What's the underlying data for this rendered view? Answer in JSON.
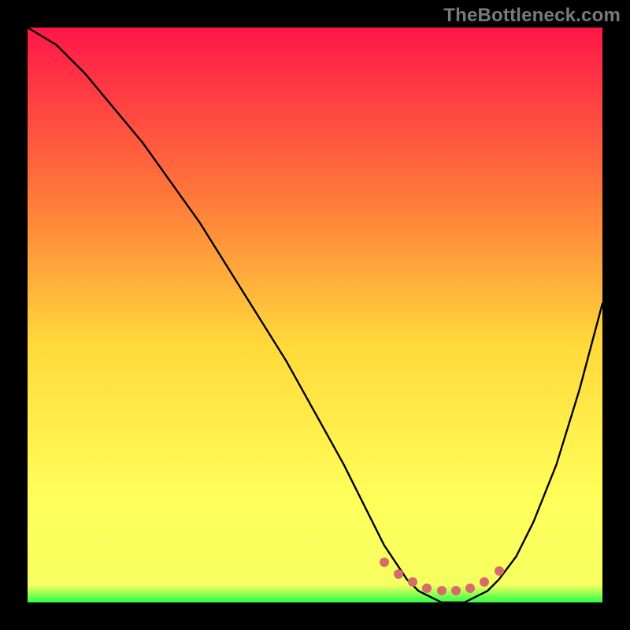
{
  "watermark": "TheBottleneck.com",
  "colors": {
    "bg": "#000000",
    "wm": "#7a7a7a",
    "curve": "#000000",
    "markers": "#d96a6a",
    "grad_top": "#ff1648",
    "grad_mid1": "#ff7a3a",
    "grad_mid2": "#ffd93a",
    "grad_mid3": "#ffff5a",
    "grad_bottom": "#2cff48"
  },
  "chart_data": {
    "type": "line",
    "title": "",
    "xlabel": "",
    "ylabel": "",
    "xlim": [
      0,
      100
    ],
    "ylim": [
      0,
      100
    ],
    "series": [
      {
        "name": "bottleneck-curve",
        "x": [
          0,
          5,
          10,
          15,
          20,
          25,
          30,
          35,
          40,
          45,
          50,
          55,
          60,
          62,
          64,
          66,
          68,
          70,
          72,
          74,
          76,
          78,
          80,
          82,
          85,
          88,
          92,
          96,
          100
        ],
        "y": [
          100,
          97,
          92,
          86,
          80,
          73,
          66,
          58,
          50,
          42,
          33,
          24,
          14,
          10,
          7,
          4,
          2,
          1,
          0,
          0,
          0,
          1,
          2,
          4,
          8,
          14,
          24,
          37,
          52
        ]
      }
    ],
    "markers": {
      "name": "optimal-range",
      "x": [
        62,
        64.5,
        67,
        69.5,
        72,
        74.5,
        77,
        79.5,
        82
      ],
      "y": [
        7,
        5,
        3.5,
        2.5,
        2,
        2,
        2.5,
        3.5,
        5.5
      ]
    },
    "gradient_stops": [
      {
        "offset": 0,
        "color": "#ff1648"
      },
      {
        "offset": 30,
        "color": "#ff7a3a"
      },
      {
        "offset": 55,
        "color": "#ffd93a"
      },
      {
        "offset": 82,
        "color": "#ffff5a"
      },
      {
        "offset": 97,
        "color": "#f5ff60"
      },
      {
        "offset": 100,
        "color": "#2cff48"
      }
    ]
  }
}
